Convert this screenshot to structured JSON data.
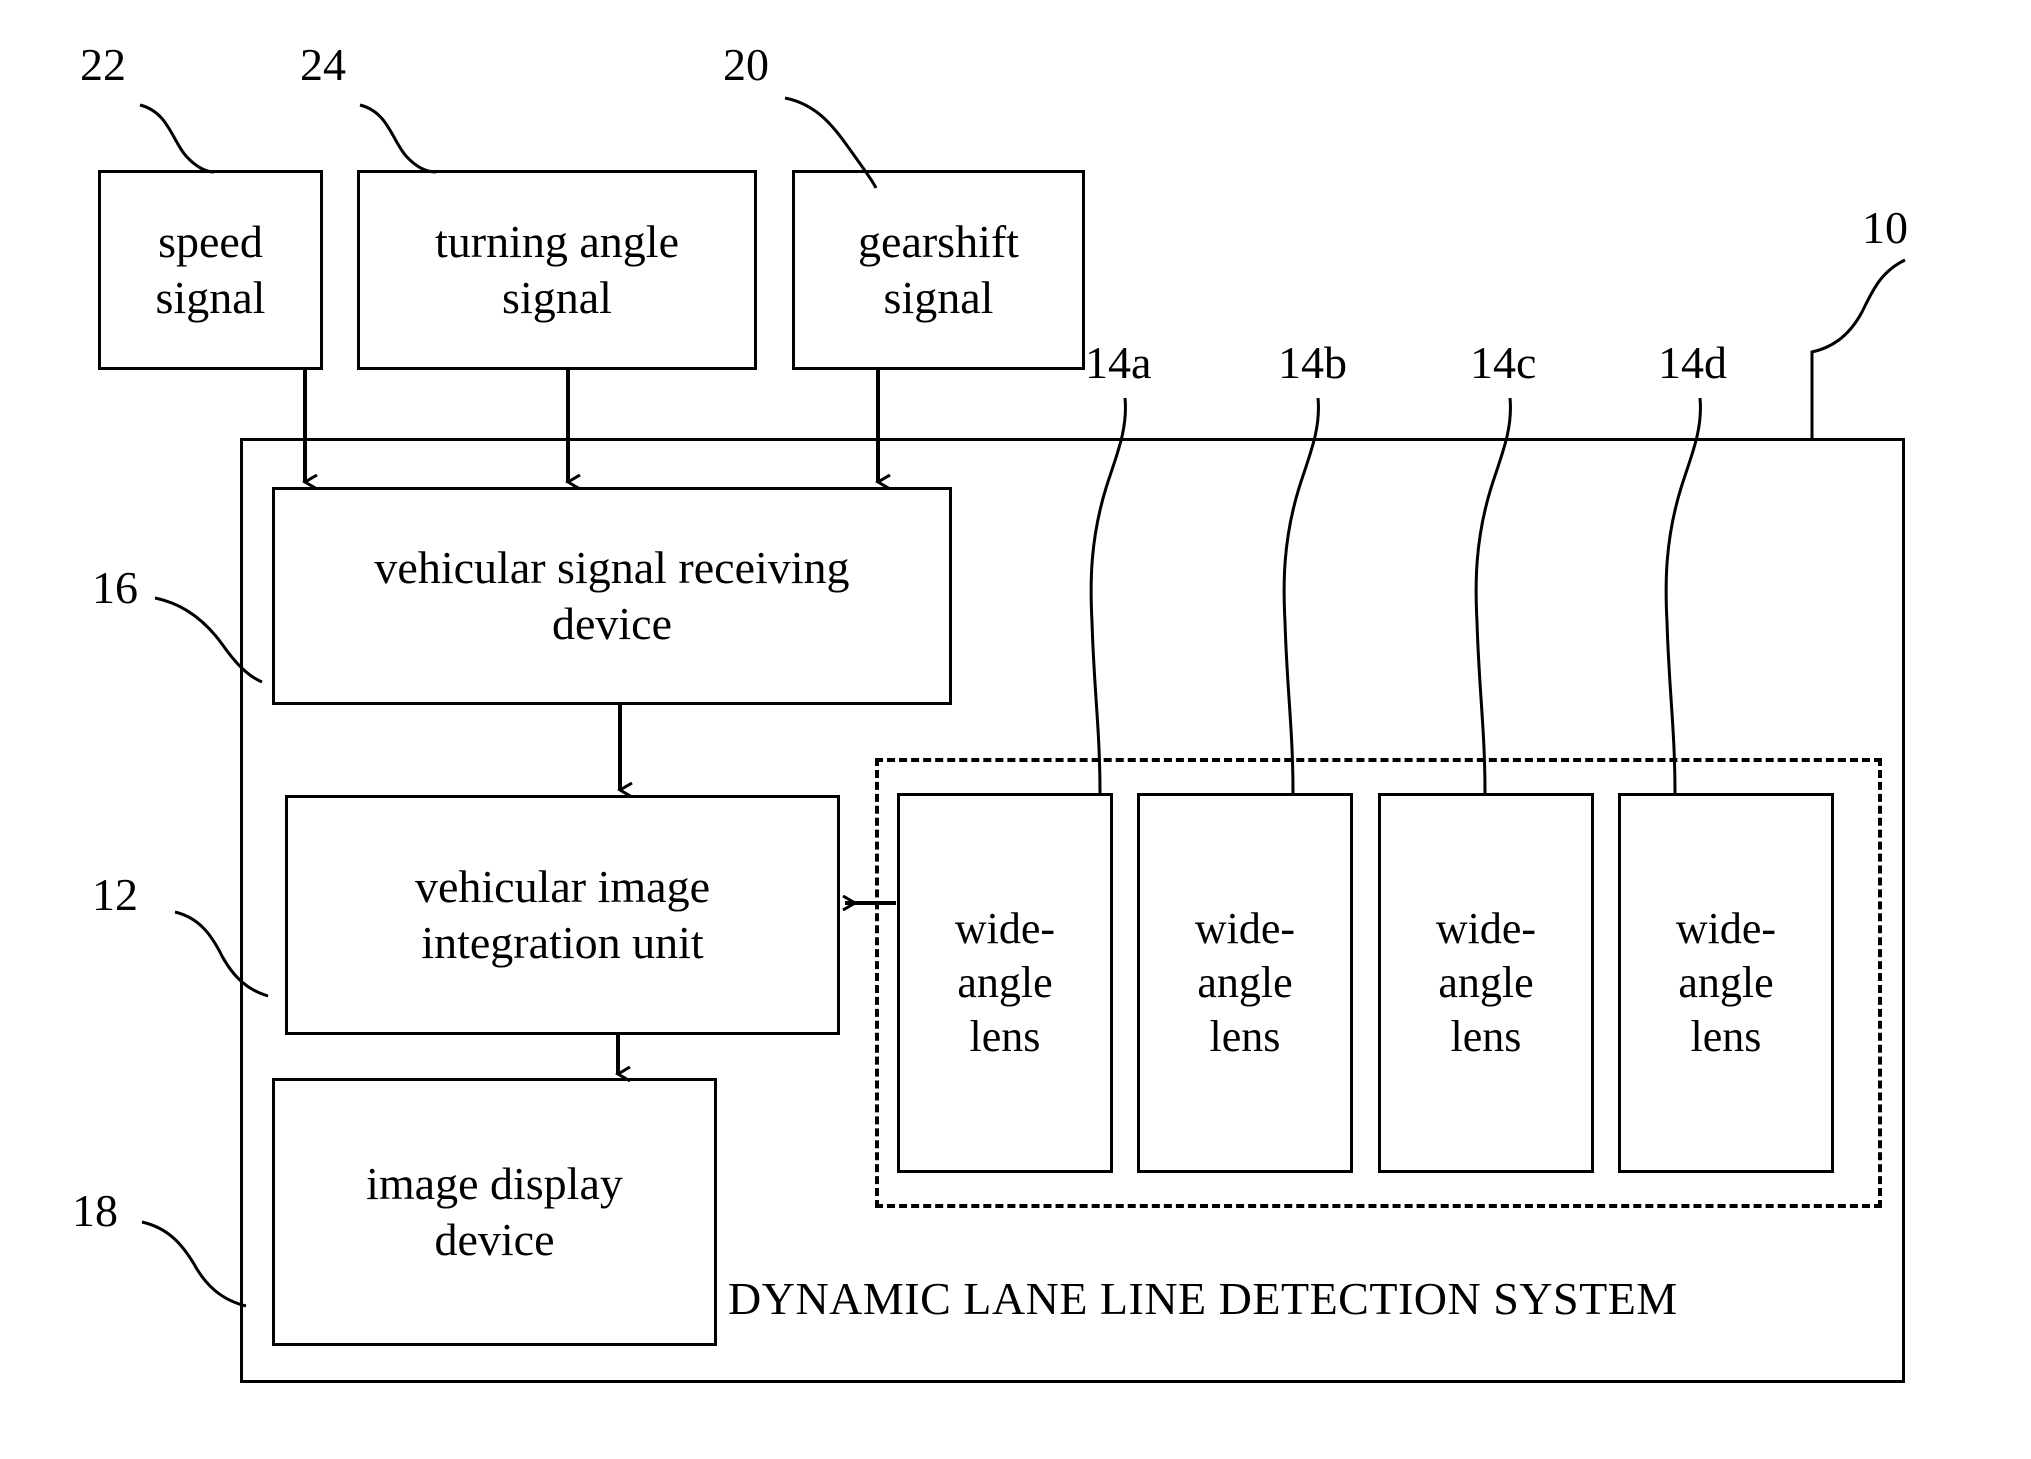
{
  "figure": {
    "kind": "patent-block-diagram",
    "background_color": "#ffffff",
    "line_color": "#000000"
  },
  "system": {
    "ref": "10",
    "title": "DYNAMIC LANE LINE DETECTION SYSTEM"
  },
  "inputs": [
    {
      "ref": "22",
      "label_line1": "speed",
      "label_line2": "signal"
    },
    {
      "ref": "24",
      "label_line1": "turning angle",
      "label_line2": "signal"
    },
    {
      "ref": "20",
      "label_line1": "gearshift",
      "label_line2": "signal"
    }
  ],
  "modules": [
    {
      "ref": "16",
      "label_line1": "vehicular signal receiving",
      "label_line2": "device"
    },
    {
      "ref": "12",
      "label_line1": "vehicular image",
      "label_line2": "integration unit"
    },
    {
      "ref": "18",
      "label_line1": "image display",
      "label_line2": "device"
    }
  ],
  "lenses": [
    {
      "ref": "14a",
      "label_line1": "wide-",
      "label_line2": "angle",
      "label_line3": "lens"
    },
    {
      "ref": "14b",
      "label_line1": "wide-",
      "label_line2": "angle",
      "label_line3": "lens"
    },
    {
      "ref": "14c",
      "label_line1": "wide-",
      "label_line2": "angle",
      "label_line3": "lens"
    },
    {
      "ref": "14d",
      "label_line1": "wide-",
      "label_line2": "angle",
      "label_line3": "lens"
    }
  ]
}
